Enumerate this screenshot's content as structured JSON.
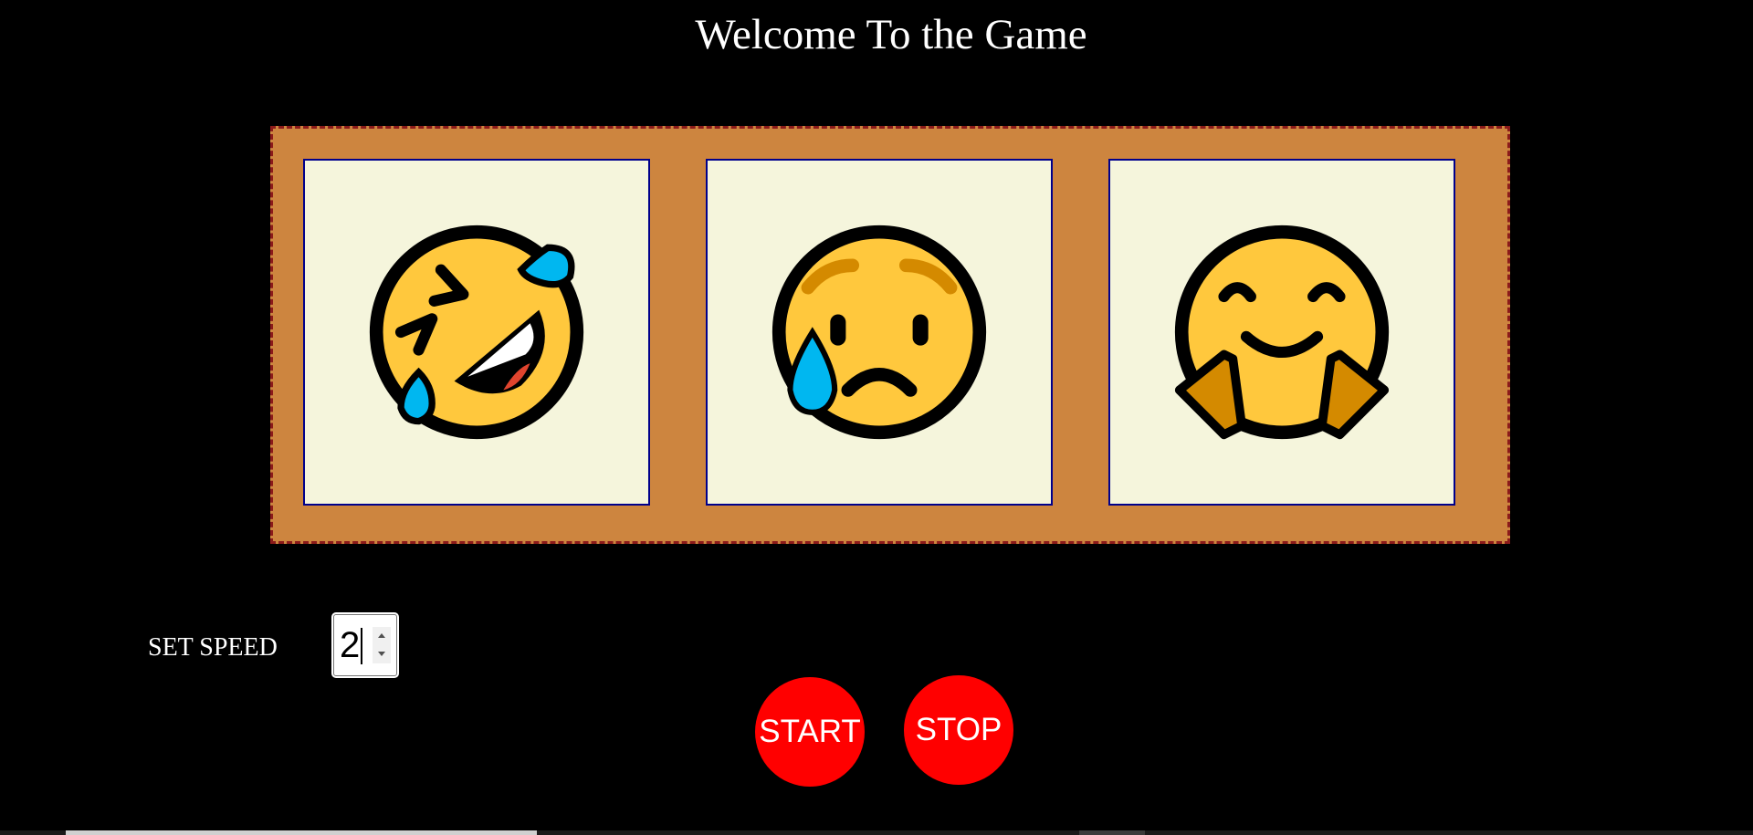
{
  "header": {
    "title": "Welcome To the Game"
  },
  "reels": [
    {
      "icon": "rolling-on-floor-laughing-emoji"
    },
    {
      "icon": "sad-but-relieved-emoji"
    },
    {
      "icon": "hugging-face-emoji"
    }
  ],
  "controls": {
    "speed_label": "SET SPEED",
    "speed_value": "2",
    "start_label": "START",
    "stop_label": "STOP"
  },
  "colors": {
    "background": "#000000",
    "machine": "#cd853f",
    "machine_border": "#8b1a1a",
    "slot": "#f5f5dc",
    "slot_border": "#00008b",
    "button": "#ff0000",
    "emoji_face": "#ffc83d",
    "tear": "#00b7f0"
  }
}
